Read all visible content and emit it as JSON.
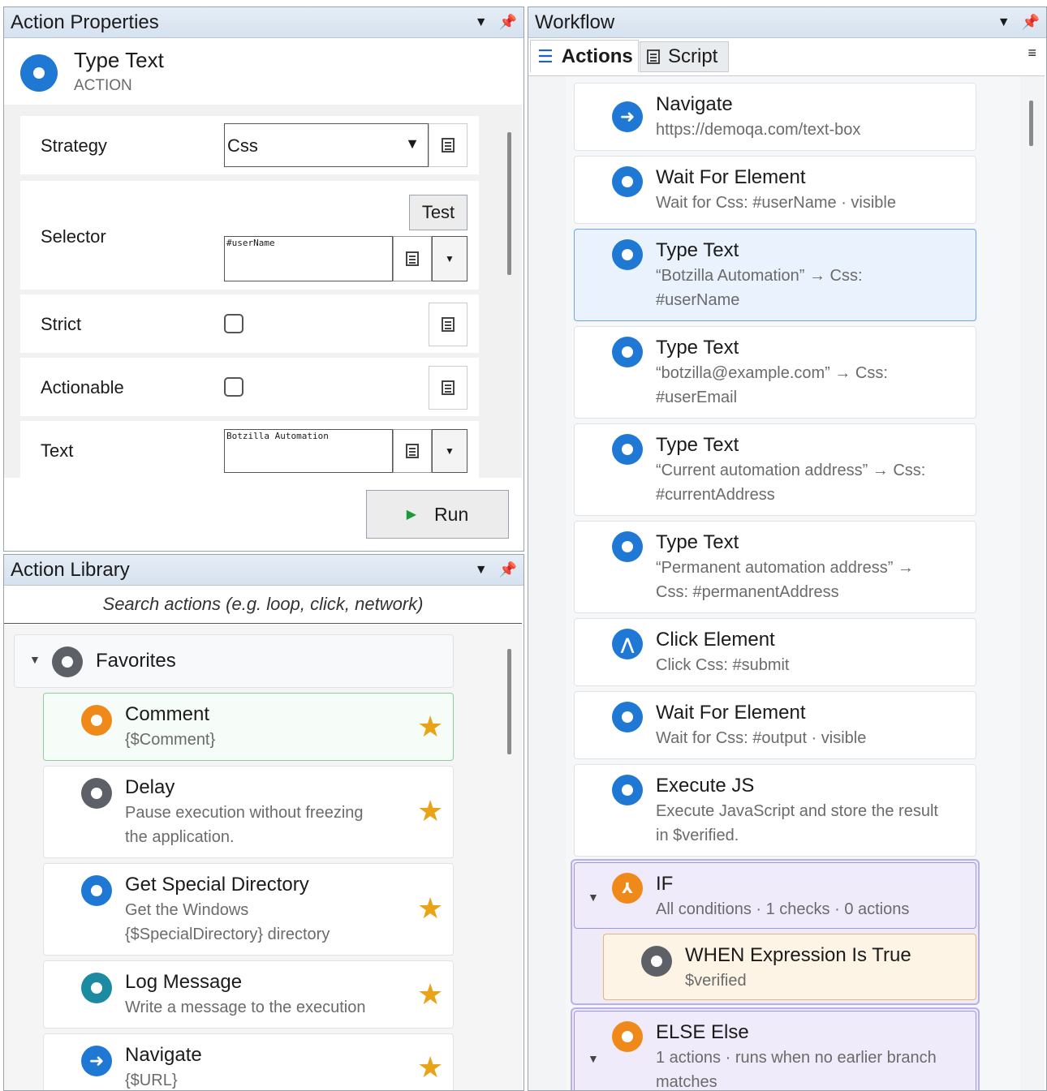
{
  "props": {
    "header_title": "Action Properties",
    "action_title": "Type Text",
    "action_type": "ACTION",
    "strategy_label": "Strategy",
    "strategy_value": "Css",
    "selector_label": "Selector",
    "test_button": "Test",
    "selector_value": "#userName",
    "strict_label": "Strict",
    "actionable_label": "Actionable",
    "text_label": "Text",
    "text_value": "Botzilla Automation",
    "run_button": "Run"
  },
  "library": {
    "header_title": "Action Library",
    "search_placeholder": "Search actions (e.g. loop, click, network)",
    "group_label": "Favorites",
    "items": [
      {
        "title": "Comment",
        "sub1": "{$Comment}",
        "sub2": ""
      },
      {
        "title": "Delay",
        "sub1": "Pause execution without freezing",
        "sub2": "the application."
      },
      {
        "title": "Get Special Directory",
        "sub1": "Get the Windows",
        "sub2": "{$SpecialDirectory} directory"
      },
      {
        "title": "Log Message",
        "sub1": "Write a message to the execution",
        "sub2": ""
      },
      {
        "title": "Navigate",
        "sub1": "{$URL}",
        "sub2": ""
      }
    ]
  },
  "workflow": {
    "header_title": "Workflow",
    "tab_actions": "Actions",
    "tab_script": "Script",
    "steps": [
      {
        "title": "Navigate",
        "sub1": "https://demoqa.com/text-box",
        "sub2": ""
      },
      {
        "title": "Wait For Element",
        "sub1": "Wait for Css: #userName · visible",
        "sub2": ""
      },
      {
        "title": "Type Text",
        "sub1": "“Botzilla Automation” → Css:",
        "sub2": "#userName"
      },
      {
        "title": "Type Text",
        "sub1": "“botzilla@example.com” → Css:",
        "sub2": "#userEmail"
      },
      {
        "title": "Type Text",
        "sub1": "“Current automation address” → Css:",
        "sub2": "#currentAddress"
      },
      {
        "title": "Type Text",
        "sub1": "“Permanent automation address” →",
        "sub2": "Css: #permanentAddress"
      },
      {
        "title": "Click Element",
        "sub1": "Click Css: #submit",
        "sub2": ""
      },
      {
        "title": "Wait For Element",
        "sub1": "Wait for Css: #output · visible",
        "sub2": ""
      },
      {
        "title": "Execute JS",
        "sub1": "Execute JavaScript and store the result",
        "sub2": "in $verified."
      }
    ],
    "if_block": {
      "title": "IF",
      "sub": "All conditions · 1 checks · 0 actions"
    },
    "when_block": {
      "title": "WHEN  Expression Is True",
      "sub": "$verified"
    },
    "else_block": {
      "title": "ELSE  Else",
      "sub1": "1 actions · runs when no earlier branch",
      "sub2": "matches"
    }
  }
}
